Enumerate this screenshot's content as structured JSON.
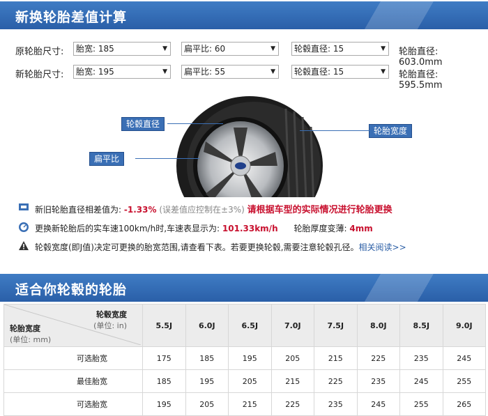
{
  "header": {
    "title": "新换轮胎差值计算"
  },
  "original": {
    "label": "原轮胎尺寸:",
    "width": "胎宽: 185",
    "ratio": "扁平比: 60",
    "rim": "轮毂直径: 15",
    "diameter": "轮胎直径: 603.0mm"
  },
  "new": {
    "label": "新轮胎尺寸:",
    "width": "胎宽: 195",
    "ratio": "扁平比: 55",
    "rim": "轮毂直径: 15",
    "diameter": "轮胎直径: 595.5mm"
  },
  "diagram": {
    "rim_label": "轮毂直径",
    "width_label": "轮胎宽度",
    "ratio_label": "扁平比"
  },
  "results": {
    "diff_prefix": "新旧轮胎直径相差值为:",
    "diff_value": "-1.33%",
    "diff_note": "(误差值应控制在±3%)",
    "diff_warning": "请根据车型的实际情况进行轮胎更换",
    "speed_prefix": "更换新轮胎后的实车速100km/h时,车速表显示为:",
    "speed_value": "101.33km/h",
    "thick_prefix": "轮胎厚度变薄:",
    "thick_value": "4mm",
    "rim_note": "轮毂宽度(即J值)决定可更换的胎宽范围,请查看下表。若要更换轮毂,需要注意轮毂孔径。",
    "rim_link": "相关阅读>>"
  },
  "section2": {
    "title": "适合你轮毂的轮胎"
  },
  "table": {
    "corner_top": "轮毂宽度",
    "corner_top_unit": "(单位: in)",
    "corner_bottom": "轮胎宽度",
    "corner_bottom_unit": "(单位: mm)",
    "columns": [
      "5.5J",
      "6.0J",
      "6.5J",
      "7.0J",
      "7.5J",
      "8.0J",
      "8.5J",
      "9.0J"
    ],
    "rows": [
      {
        "label": "可选胎宽",
        "values": [
          "175",
          "185",
          "195",
          "205",
          "215",
          "225",
          "235",
          "245"
        ]
      },
      {
        "label": "最佳胎宽",
        "values": [
          "185",
          "195",
          "205",
          "215",
          "225",
          "235",
          "245",
          "255"
        ]
      },
      {
        "label": "可选胎宽",
        "values": [
          "195",
          "205",
          "215",
          "225",
          "235",
          "245",
          "255",
          "265"
        ]
      }
    ]
  },
  "colors": {
    "accent": "#2a5fa8",
    "warning": "#c8102e",
    "tag": "#3a6fb5"
  }
}
